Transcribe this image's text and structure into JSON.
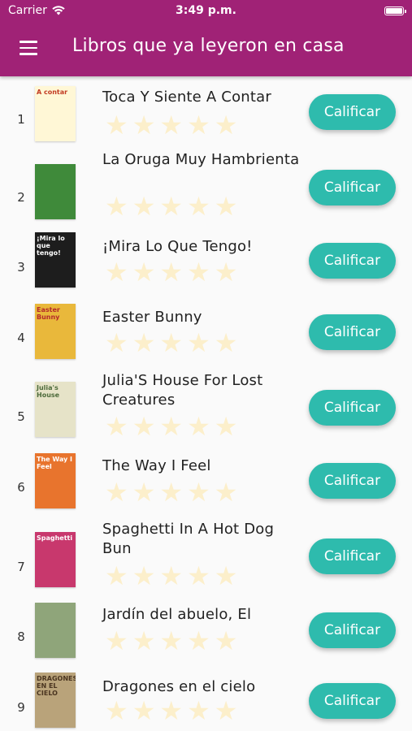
{
  "status_bar": {
    "carrier": "Carrier",
    "time": "3:49 p.m."
  },
  "header": {
    "title": "Libros que ya leyeron en casa"
  },
  "rate_label": "Calificar",
  "star_glyph": "★",
  "books": [
    {
      "index": "1",
      "title": "Toca Y Siente A Contar",
      "cover_text": "A contar",
      "cover_bg": "#fff7d6",
      "cover_fg": "#c23b22",
      "rating": 0
    },
    {
      "index": "2",
      "title": "La Oruga Muy Hambrienta",
      "cover_text": "",
      "cover_bg": "#3f8a3a",
      "cover_fg": "#ffffff",
      "rating": 0
    },
    {
      "index": "3",
      "title": "¡Mira Lo Que Tengo!",
      "cover_text": "¡Mira lo que tengo!",
      "cover_bg": "#1d1d1d",
      "cover_fg": "#ffffff",
      "rating": 0
    },
    {
      "index": "4",
      "title": "Easter Bunny",
      "cover_text": "Easter Bunny",
      "cover_bg": "#e9b83b",
      "cover_fg": "#b42a2a",
      "rating": 0
    },
    {
      "index": "5",
      "title": "Julia'S House For Lost Creatures",
      "cover_text": "Julia's House",
      "cover_bg": "#e6e3c8",
      "cover_fg": "#4d6b3b",
      "rating": 0
    },
    {
      "index": "6",
      "title": "The Way I Feel",
      "cover_text": "The Way I Feel",
      "cover_bg": "#e8742d",
      "cover_fg": "#ffffff",
      "rating": 0
    },
    {
      "index": "7",
      "title": "Spaghetti In A Hot Dog Bun",
      "cover_text": "Spaghetti",
      "cover_bg": "#c8386d",
      "cover_fg": "#ffffff",
      "rating": 0
    },
    {
      "index": "8",
      "title": "Jardín del abuelo, El",
      "cover_text": "",
      "cover_bg": "#8fa57a",
      "cover_fg": "#2f4a2a",
      "rating": 0
    },
    {
      "index": "9",
      "title": "Dragones en el cielo",
      "cover_text": "DRAGONES EN EL CIELO",
      "cover_bg": "#b9a37a",
      "cover_fg": "#4a3520",
      "rating": 0
    }
  ],
  "colors": {
    "header": "#a02276",
    "button": "#2ebbad",
    "star_empty": "#fcefcb",
    "star_filled": "#f5c518"
  }
}
